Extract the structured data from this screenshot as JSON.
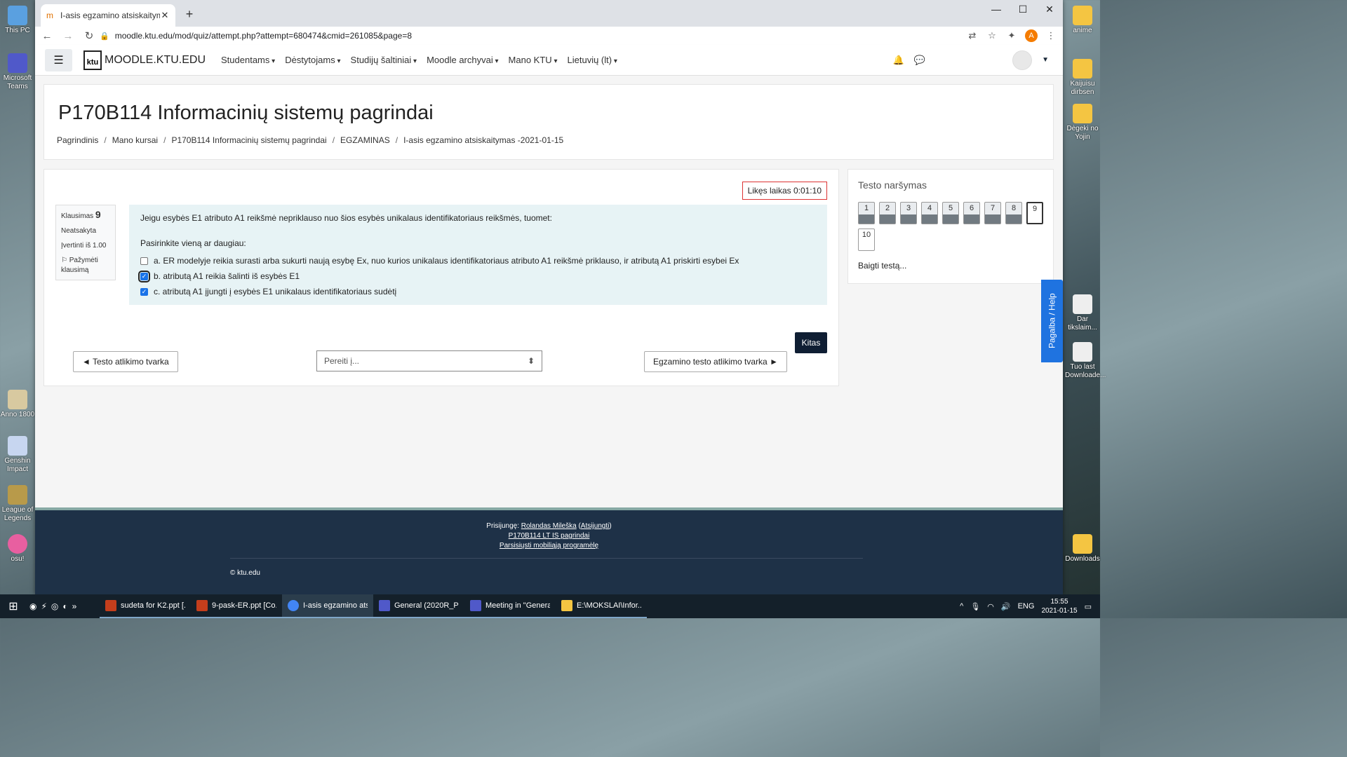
{
  "desktop": {
    "left_icons": [
      "This PC",
      "Microsoft Teams",
      "Anno 1800",
      "Genshin Impact",
      "League of Legends",
      "osu!"
    ],
    "right_icons": [
      "anime",
      "Kaijuisu dirbsen",
      "Dėgeki no Yojin",
      "Dar tikslaim...",
      "Tuo last Downloade...",
      "Downloads"
    ]
  },
  "browser": {
    "tab_title": "I-asis egzamino atsiskaitymas -2(",
    "url": "moodle.ktu.edu/mod/quiz/attempt.php?attempt=680474&cmid=261085&page=8",
    "profile_letter": "A"
  },
  "navbar": {
    "site_name": "MOODLE.KTU.EDU",
    "logo_text": "ktu",
    "menus": [
      "Studentams",
      "Dėstytojams",
      "Studijų šaltiniai",
      "Moodle archyvai",
      "Mano KTU",
      "Lietuvių (lt)"
    ]
  },
  "header": {
    "title": "P170B114 Informacinių sistemų pagrindai",
    "breadcrumbs": [
      "Pagrindinis",
      "Mano kursai",
      "P170B114 Informacinių sistemų pagrindai",
      "EGZAMINAS",
      "I-asis egzamino atsiskaitymas -2021-01-15"
    ]
  },
  "quiz": {
    "timer": "Likęs laikas 0:01:10",
    "question_label": "Klausimas",
    "question_number": "9",
    "status": "Neatsakyta",
    "grade": "Įvertinti iš 1.00",
    "flag": "Pažymėti klausimą",
    "question_text": "Jeigu esybės E1 atributo A1 reikšmė nepriklauso nuo šios esybės unikalaus identifikatoriaus reikšmės, tuomet:",
    "prompt": "Pasirinkite vieną ar daugiau:",
    "answers": [
      {
        "text": "a. ER modelyje reikia surasti arba sukurti naują esybę Ex, nuo kurios unikalaus identifikatoriaus atributo A1 reikšmė priklauso, ir atributą A1 priskirti esybei Ex",
        "checked": false
      },
      {
        "text": "b. atributą A1 reikia šalinti iš esybės E1",
        "checked": true
      },
      {
        "text": "c. atributą A1 įjungti į esybės E1 unikalaus identifikatoriaus sudėtį",
        "checked": true
      }
    ],
    "next_button": "Kitas",
    "prev_link": "◄ Testo atlikimo tvarka",
    "jump_placeholder": "Pereiti į...",
    "next_link": "Egzamino testo atlikimo tvarka ►"
  },
  "quiz_nav": {
    "title": "Testo naršymas",
    "buttons": [
      "1",
      "2",
      "3",
      "4",
      "5",
      "6",
      "7",
      "8",
      "9",
      "10"
    ],
    "finish": "Baigti testą..."
  },
  "help_tab": "Pagalba / Help",
  "footer": {
    "logged_in_prefix": "Prisijungę: ",
    "user": "Rolandas Mileška",
    "logout": "Atsijungti",
    "course_link": "P170B114 LT IS pagrindai",
    "mobile_app": "Parsisiųsti mobiliąją programėlę",
    "copyright": "© ktu.edu"
  },
  "taskbar": {
    "items": [
      {
        "label": "sudeta for K2.ppt [...",
        "color": "#c43e1c"
      },
      {
        "label": "9-pask-ER.ppt [Co...",
        "color": "#c43e1c"
      },
      {
        "label": "I-asis egzamino atsi...",
        "color": "#4285f4"
      },
      {
        "label": "General (2020R_P17...",
        "color": "#5059c9"
      },
      {
        "label": "Meeting in \"Genera...",
        "color": "#5059c9"
      },
      {
        "label": "E:\\MOKSLAI\\Infor...",
        "color": "#f4c542"
      }
    ],
    "lang": "ENG",
    "time": "15:55",
    "date": "2021-01-15"
  }
}
